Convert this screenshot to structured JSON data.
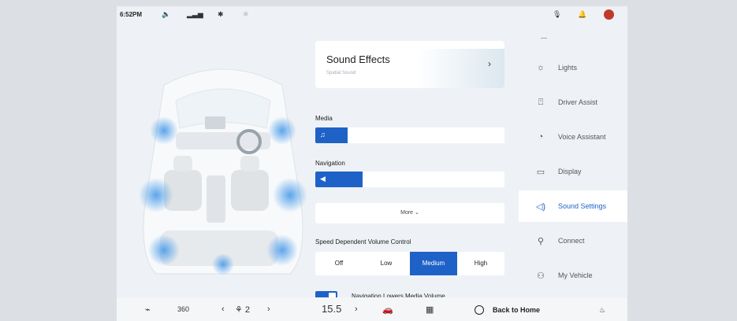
{
  "status_bar": {
    "time": "6:52PM",
    "icons": [
      "volume-icon",
      "signal-icon",
      "bluetooth-icon",
      "mic-icon",
      "bell-icon",
      "avatar"
    ]
  },
  "sound_effects": {
    "title": "Sound Effects",
    "subtitle": "Spatial Sound",
    "chevron": "›"
  },
  "media": {
    "label": "Media",
    "icon": "♫",
    "level": 0.17
  },
  "navigation": {
    "label": "Navigation",
    "icon": "◀",
    "level": 0.25
  },
  "more": {
    "label": "More ⌄"
  },
  "speed_volume": {
    "label": "Speed Dependent Volume Control",
    "options": [
      "Off",
      "Low",
      "Medium",
      "High"
    ],
    "selected": "Medium"
  },
  "nav_lowers_media": {
    "label": "Navigation Lowers Media Volume",
    "enabled": true
  },
  "sidebar": {
    "items": [
      {
        "label": "Lights",
        "icon": "☼",
        "icon_name": "light-icon"
      },
      {
        "label": "Driver Assist",
        "icon": "⍞",
        "icon_name": "driver-assist-icon"
      },
      {
        "label": "Voice Assistant",
        "icon": "◔",
        "icon_name": "voice-assistant-icon"
      },
      {
        "label": "Display",
        "icon": "▭",
        "icon_name": "display-icon"
      },
      {
        "label": "Sound Settings",
        "icon": "◁)",
        "icon_name": "speaker-icon",
        "active": true
      },
      {
        "label": "Connect",
        "icon": "⚲",
        "icon_name": "connect-icon"
      },
      {
        "label": "My Vehicle",
        "icon": "⚇",
        "icon_name": "vehicle-icon"
      }
    ]
  },
  "dock": {
    "cam360": "360",
    "fan_left": "‹",
    "fan_speed": "⚘ 2",
    "fan_right": "›",
    "temperature": "15.5",
    "temp_right": "›",
    "home_label": "Back to Home"
  },
  "colors": {
    "accent": "#1f62c7",
    "background": "#eef2f6"
  }
}
